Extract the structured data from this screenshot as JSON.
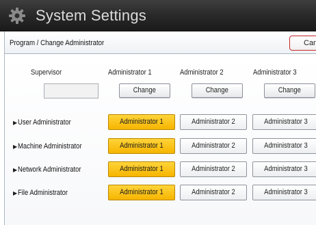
{
  "window": {
    "title": "System Settings",
    "title_icon": "gear-icon"
  },
  "header": {
    "title": "Program / Change Administrator",
    "cancel_label": "Cancel"
  },
  "columns": {
    "supervisor": "Supervisor",
    "admin1": "Administrator 1",
    "admin2": "Administrator 2",
    "admin3": "Administrator 3",
    "change_label": "Change"
  },
  "rows": [
    {
      "label": "User Administrator",
      "selected": "Administrator 1"
    },
    {
      "label": "Machine Administrator",
      "selected": "Administrator 1"
    },
    {
      "label": "Network Administrator",
      "selected": "Administrator 1"
    },
    {
      "label": "File Administrator",
      "selected": "Administrator 1"
    }
  ],
  "options": [
    "Administrator 1",
    "Administrator 2",
    "Administrator 3"
  ],
  "colors": {
    "selected": "#f8c21a",
    "titlebar": "#2b2b2b",
    "cancel_border": "#c8262a"
  }
}
